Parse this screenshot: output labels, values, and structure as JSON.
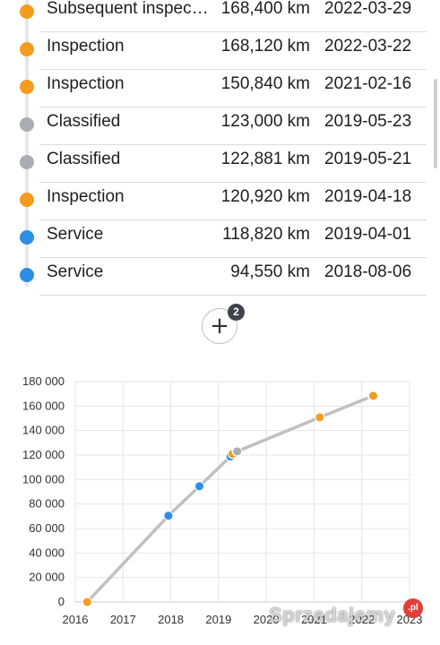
{
  "history": {
    "items": [
      {
        "event": "Subsequent inspecti...",
        "km": "168,400 km",
        "date": "2022-03-29",
        "color": "#f39c1e"
      },
      {
        "event": "Inspection",
        "km": "168,120 km",
        "date": "2022-03-22",
        "color": "#f39c1e"
      },
      {
        "event": "Inspection",
        "km": "150,840 km",
        "date": "2021-02-16",
        "color": "#f39c1e"
      },
      {
        "event": "Classified",
        "km": "123,000 km",
        "date": "2019-05-23",
        "color": "#a9adb4"
      },
      {
        "event": "Classified",
        "km": "122,881 km",
        "date": "2019-05-21",
        "color": "#a9adb4"
      },
      {
        "event": "Inspection",
        "km": "120,920 km",
        "date": "2019-04-18",
        "color": "#f39c1e"
      },
      {
        "event": "Service",
        "km": "118,820 km",
        "date": "2019-04-01",
        "color": "#2d8ee6"
      },
      {
        "event": "Service",
        "km": "94,550 km",
        "date": "2018-08-06",
        "color": "#2d8ee6"
      }
    ]
  },
  "expand": {
    "icon": "plus-icon",
    "symbol": "+",
    "count": "2"
  },
  "chart_data": {
    "type": "scatter",
    "line_color": "#c0c0c0",
    "grid": true,
    "xlim": [
      2016,
      2023
    ],
    "ylim": [
      0,
      180000
    ],
    "x_ticks": [
      "2016",
      "2017",
      "2018",
      "2019",
      "2020",
      "2021",
      "2022",
      "2023"
    ],
    "y_ticks": [
      "0",
      "20 000",
      "40 000",
      "60 000",
      "80 000",
      "100 000",
      "120 000",
      "140 000",
      "160 000",
      "180 000"
    ],
    "points": [
      {
        "x": 2016.25,
        "y": 0,
        "color": "#f39c1e"
      },
      {
        "x": 2017.95,
        "y": 70500,
        "color": "#2d8ee6"
      },
      {
        "x": 2018.6,
        "y": 94550,
        "color": "#2d8ee6"
      },
      {
        "x": 2019.25,
        "y": 118820,
        "color": "#2d8ee6"
      },
      {
        "x": 2019.29,
        "y": 120920,
        "color": "#f39c1e"
      },
      {
        "x": 2019.38,
        "y": 122881,
        "color": "#a9adb4"
      },
      {
        "x": 2019.39,
        "y": 123000,
        "color": "#a9adb4"
      },
      {
        "x": 2021.12,
        "y": 150840,
        "color": "#f39c1e"
      },
      {
        "x": 2022.22,
        "y": 168120,
        "color": "#f39c1e"
      },
      {
        "x": 2022.24,
        "y": 168400,
        "color": "#f39c1e"
      }
    ]
  },
  "watermark": {
    "text": "Sprzedajemy",
    "badge": ".pl"
  }
}
